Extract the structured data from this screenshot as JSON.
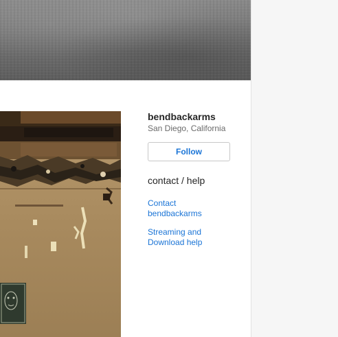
{
  "artist": {
    "name": "bendbackarms",
    "location": "San Diego, California"
  },
  "follow_button": {
    "label": "Follow"
  },
  "contact_section": {
    "heading": "contact / help",
    "links": [
      {
        "line1": "Contact",
        "line2": "bendbackarms"
      },
      {
        "line1": "Streaming and",
        "line2": "Download help"
      }
    ]
  },
  "colors": {
    "link": "#1a74d6",
    "text": "#262626",
    "muted": "#6a6a6a",
    "page_background": "#f6f6f6"
  }
}
